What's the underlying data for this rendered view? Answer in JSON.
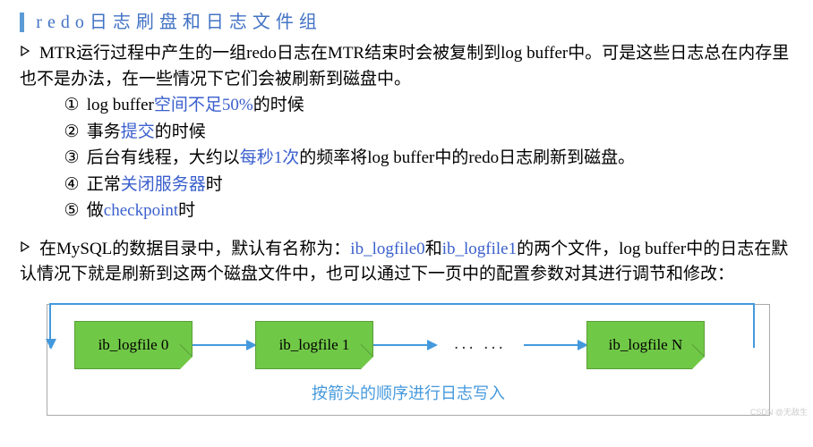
{
  "title": "redo日志刷盘和日志文件组",
  "p1": {
    "line": "MTR运行过程中产生的一组redo日志在MTR结束时会被复制到log buffer中。可是这些日志总在内存里也不是办法，在一些情况下它们会被刷新到磁盘中。",
    "items": [
      {
        "num": "①",
        "pre": "log buffer",
        "hl": "空间不足50%",
        "post": "的时候"
      },
      {
        "num": "②",
        "pre": "事务",
        "hl": "提交",
        "post": "的时候"
      },
      {
        "num": "③",
        "pre": "后台有线程，大约以",
        "hl": "每秒1次",
        "post": "的频率将log buffer中的redo日志刷新到磁盘。"
      },
      {
        "num": "④",
        "pre": "正常",
        "hl": "关闭服务器",
        "post": "时"
      },
      {
        "num": "⑤",
        "pre": "做",
        "hl": "checkpoint",
        "post": "时"
      }
    ]
  },
  "p2": {
    "pre": "在MySQL的数据目录中，默认有名称为：",
    "hl1": "ib_logfile0",
    "mid1": "和",
    "hl2": "ib_logfile1",
    "post": "的两个文件，log buffer中的日志在默认情况下就是刷新到这两个磁盘文件中，也可以通过下一页中的配置参数对其进行调节和修改："
  },
  "diagram": {
    "n0": "ib_logfile 0",
    "n1": "ib_logfile 1",
    "dots": "... ...",
    "nN": "ib_logfile N",
    "caption": "按箭头的顺序进行日志写入"
  },
  "watermark": "CSDN @无敌生"
}
